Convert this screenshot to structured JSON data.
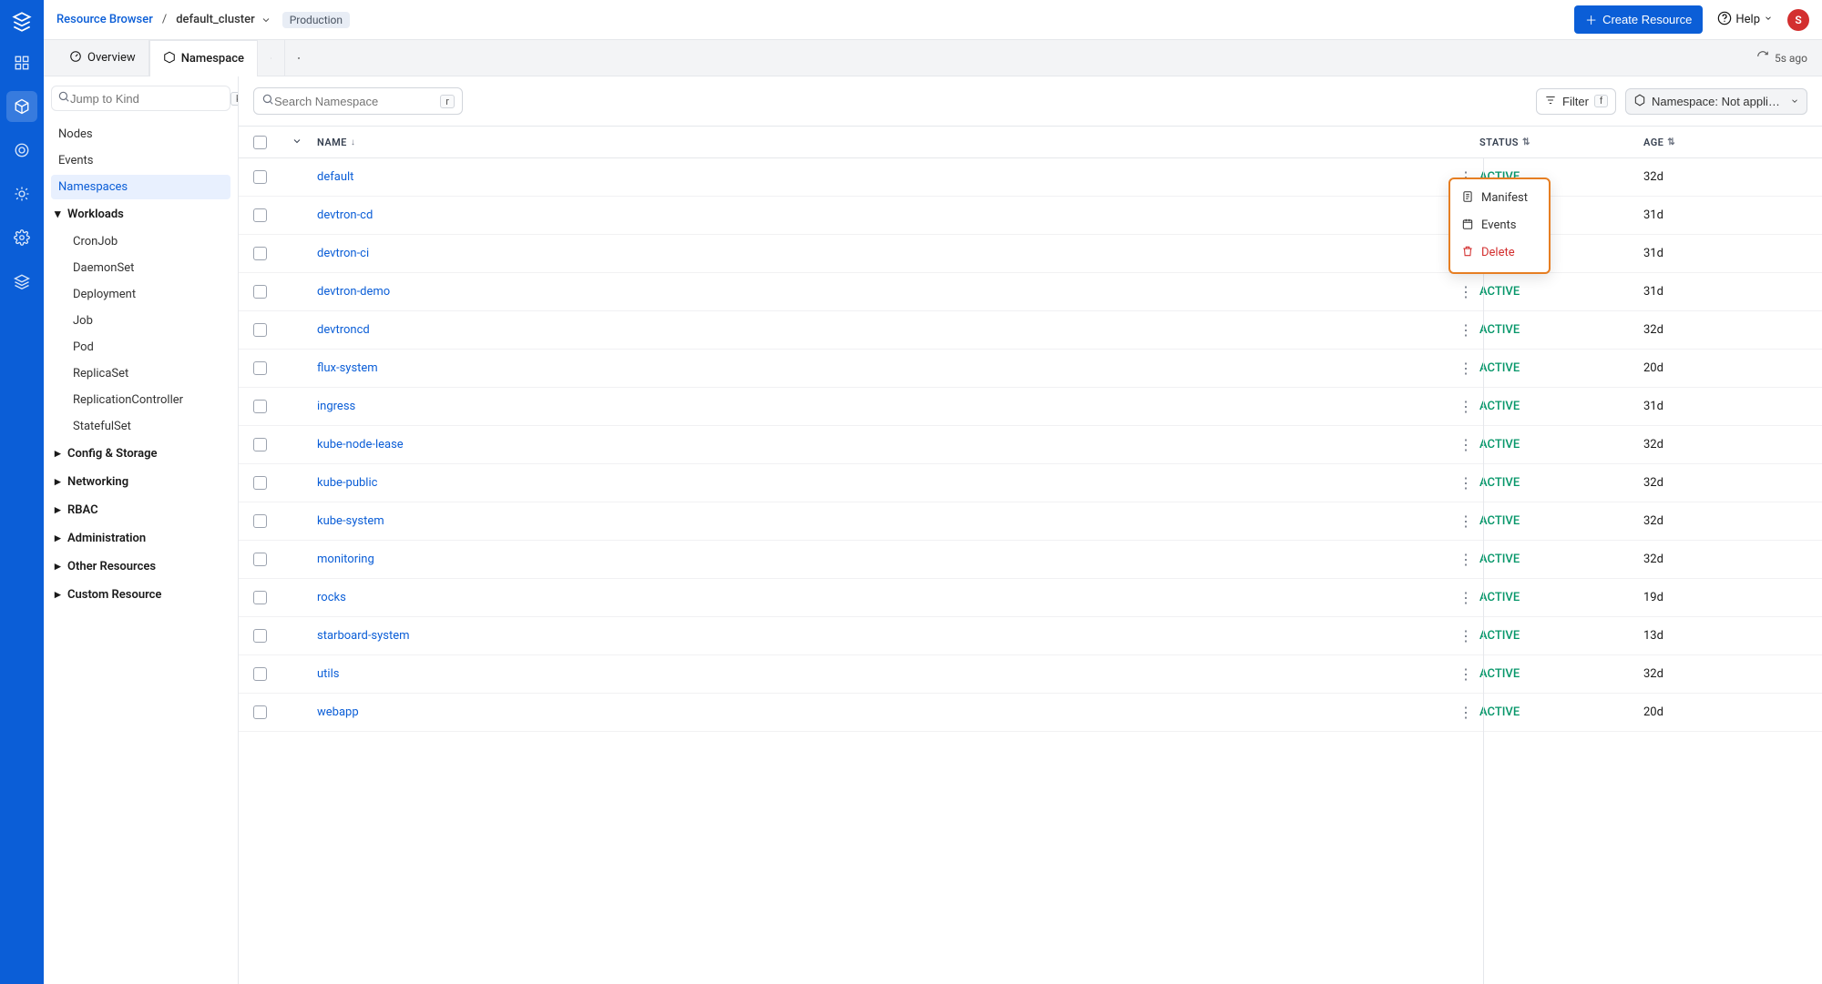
{
  "header": {
    "breadcrumb_root": "Resource Browser",
    "breadcrumb_sep": "/",
    "cluster_name": "default_cluster",
    "env_badge": "Production",
    "create_button": "Create Resource",
    "help_label": "Help",
    "avatar_initial": "S"
  },
  "tabs": {
    "overview": "Overview",
    "namespace": "Namespace",
    "refresh_label": "5s ago"
  },
  "sidebar": {
    "jump_placeholder": "Jump to Kind",
    "jump_key": "k",
    "items_top": [
      "Nodes",
      "Events",
      "Namespaces"
    ],
    "groups": [
      {
        "label": "Workloads",
        "expanded": true,
        "children": [
          "CronJob",
          "DaemonSet",
          "Deployment",
          "Job",
          "Pod",
          "ReplicaSet",
          "ReplicationController",
          "StatefulSet"
        ]
      },
      {
        "label": "Config & Storage",
        "expanded": false
      },
      {
        "label": "Networking",
        "expanded": false
      },
      {
        "label": "RBAC",
        "expanded": false
      },
      {
        "label": "Administration",
        "expanded": false
      },
      {
        "label": "Other Resources",
        "expanded": false
      },
      {
        "label": "Custom Resource",
        "expanded": false
      }
    ]
  },
  "toolbar": {
    "search_placeholder": "Search Namespace",
    "search_key": "r",
    "filter_label": "Filter",
    "filter_key": "f",
    "ns_label": "Namespace: Not applicable"
  },
  "columns": {
    "name": "NAME",
    "status": "STATUS",
    "age": "AGE"
  },
  "rows": [
    {
      "name": "default",
      "status": "ACTIVE",
      "age": "32d"
    },
    {
      "name": "devtron-cd",
      "status": "",
      "age": "31d"
    },
    {
      "name": "devtron-ci",
      "status": "",
      "age": "31d"
    },
    {
      "name": "devtron-demo",
      "status": "ACTIVE",
      "age": "31d"
    },
    {
      "name": "devtroncd",
      "status": "ACTIVE",
      "age": "32d"
    },
    {
      "name": "flux-system",
      "status": "ACTIVE",
      "age": "20d"
    },
    {
      "name": "ingress",
      "status": "ACTIVE",
      "age": "31d"
    },
    {
      "name": "kube-node-lease",
      "status": "ACTIVE",
      "age": "32d"
    },
    {
      "name": "kube-public",
      "status": "ACTIVE",
      "age": "32d"
    },
    {
      "name": "kube-system",
      "status": "ACTIVE",
      "age": "32d"
    },
    {
      "name": "monitoring",
      "status": "ACTIVE",
      "age": "32d"
    },
    {
      "name": "rocks",
      "status": "ACTIVE",
      "age": "19d"
    },
    {
      "name": "starboard-system",
      "status": "ACTIVE",
      "age": "13d"
    },
    {
      "name": "utils",
      "status": "ACTIVE",
      "age": "32d"
    },
    {
      "name": "webapp",
      "status": "ACTIVE",
      "age": "20d"
    }
  ],
  "popover": {
    "manifest": "Manifest",
    "events": "Events",
    "delete": "Delete"
  }
}
